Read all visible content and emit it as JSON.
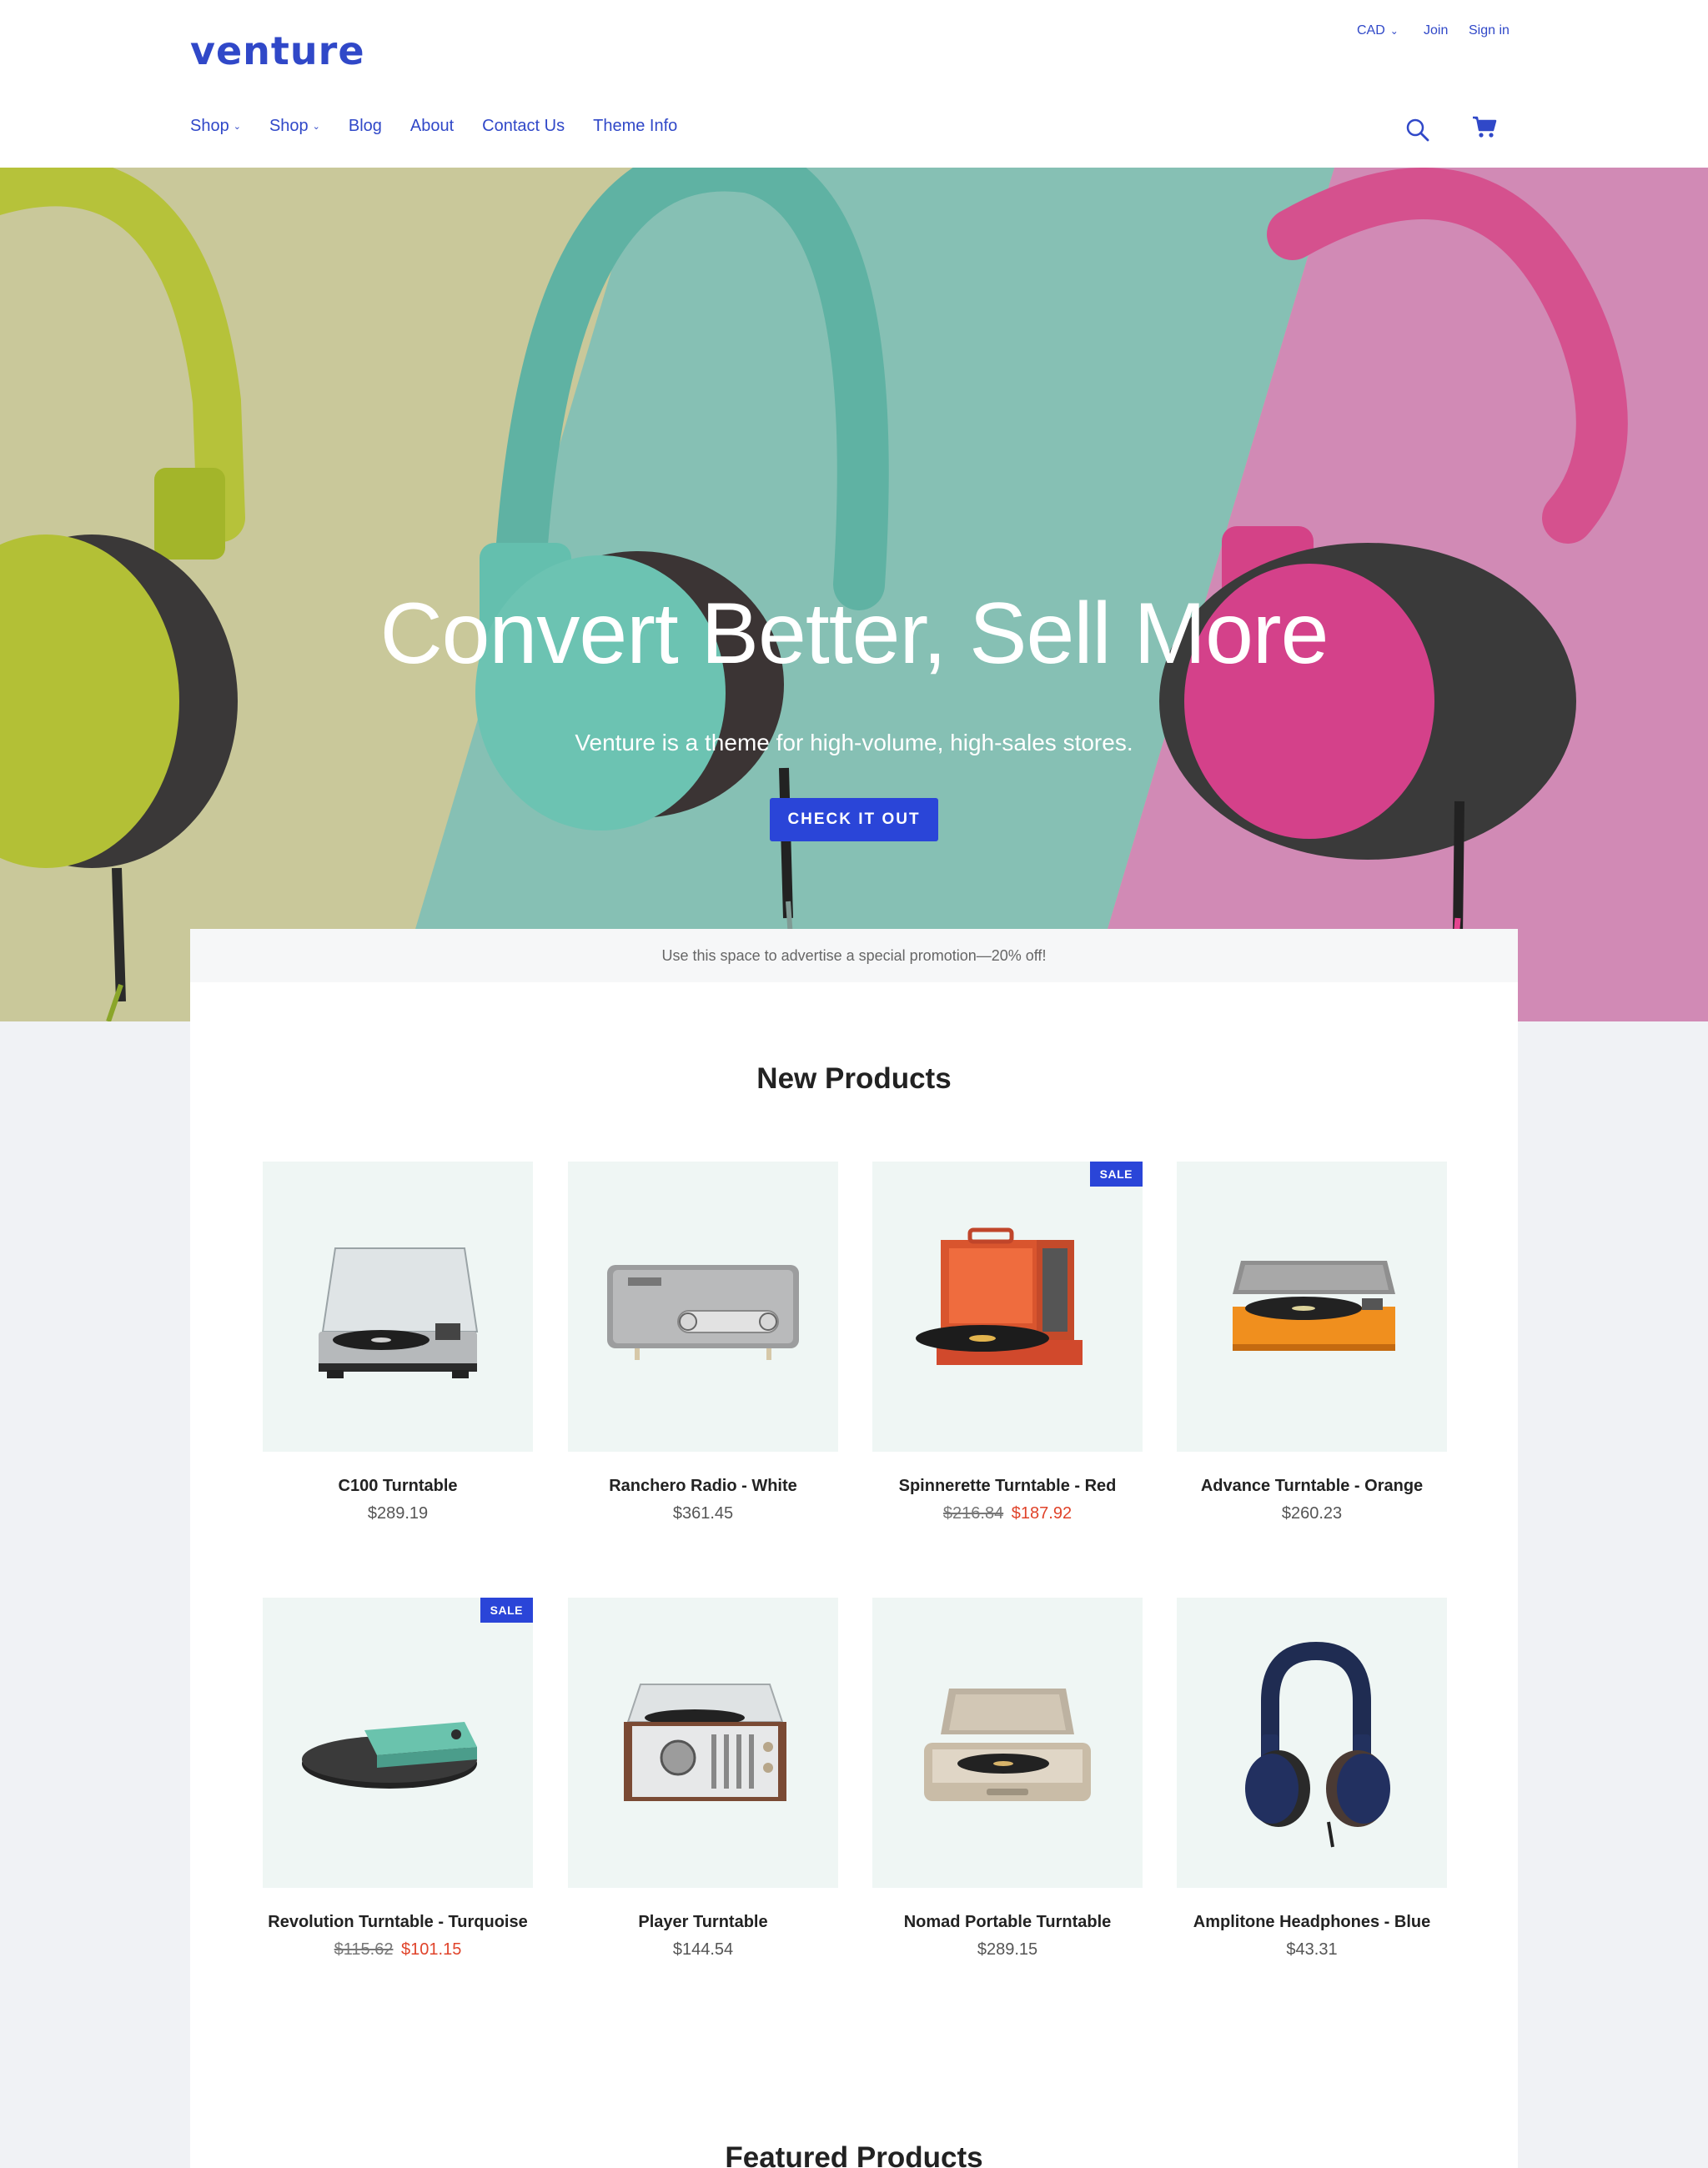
{
  "header": {
    "logo": "venture",
    "currency": "CAD",
    "join": "Join",
    "signin": "Sign in",
    "nav": [
      "Shop",
      "Shop",
      "Blog",
      "About",
      "Contact Us",
      "Theme Info"
    ],
    "search_icon": "search-icon",
    "cart_icon": "cart-icon"
  },
  "hero": {
    "title": "Convert Better, Sell More",
    "subtitle": "Venture is a theme for high-volume, high-sales stores.",
    "cta": "CHECK IT OUT",
    "slides": 3,
    "active_slide": 1,
    "colors": {
      "left": "#c9c89a",
      "middle": "#86c0b4",
      "right": "#d18ab5",
      "brand_blue": "#2a45d8"
    }
  },
  "promo": "Use this space to advertise a special promotion—20% off!",
  "sections": {
    "new_products": "New Products",
    "featured_products": "Featured Products"
  },
  "products": [
    {
      "name": "C100 Turntable",
      "price": "$289.19"
    },
    {
      "name": "Ranchero Radio - White",
      "price": "$361.45"
    },
    {
      "name": "Spinnerette Turntable - Red",
      "price_old": "$216.84",
      "price_sale": "$187.92",
      "badge": "SALE"
    },
    {
      "name": "Advance Turntable - Orange",
      "price": "$260.23"
    },
    {
      "name": "Revolution Turntable - Turquoise",
      "price_old": "$115.62",
      "price_sale": "$101.15",
      "badge": "SALE"
    },
    {
      "name": "Player Turntable",
      "price": "$144.54"
    },
    {
      "name": "Nomad Portable Turntable",
      "price": "$289.15"
    },
    {
      "name": "Amplitone Headphones - Blue",
      "price": "$43.31"
    }
  ]
}
